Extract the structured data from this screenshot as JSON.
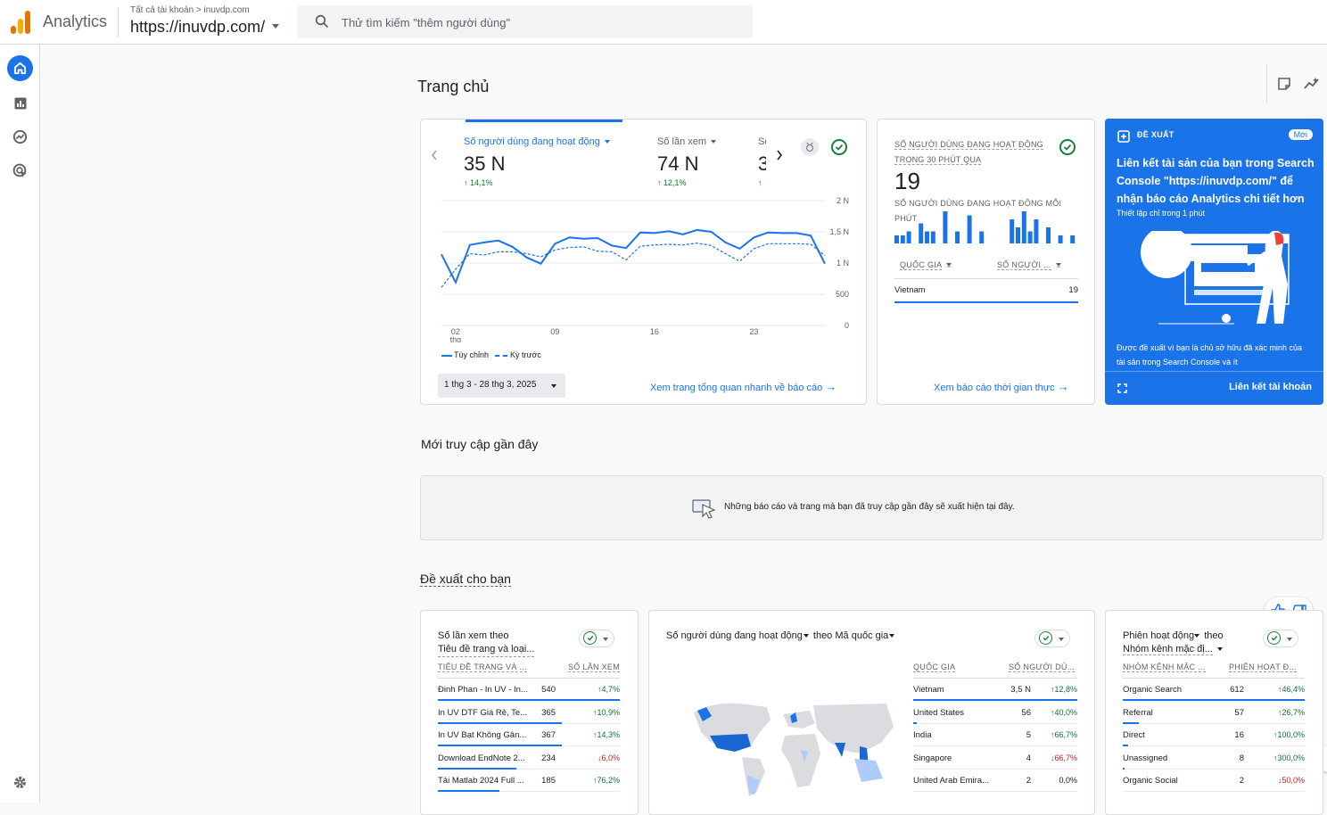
{
  "app": {
    "name": "Analytics",
    "breadcrumb": "Tất cả tài khoản > inuvdp.com",
    "property": "https://inuvdp.com/"
  },
  "search": {
    "placeholder": "Thử tìm kiếm \"thêm người dùng\""
  },
  "page": {
    "title": "Trang chủ"
  },
  "overview": {
    "metrics": [
      {
        "label": "Số người dùng đang hoạt động",
        "value": "35 N",
        "delta": "14,1%"
      },
      {
        "label": "Số lần xem",
        "value": "74 N",
        "delta": "12,1%"
      },
      {
        "label": "Số",
        "value": "3",
        "delta": ""
      }
    ],
    "legend_current": "Tùy chỉnh",
    "legend_previous": "Kỳ trước",
    "date_range": "1 thg 3 - 28 thg 3, 2025",
    "link": "Xem trang tổng quan nhanh về báo cáo"
  },
  "chart_data": {
    "type": "line",
    "x_ticks": [
      "02 thg",
      "09",
      "16",
      "23"
    ],
    "y_ticks": [
      "2 N",
      "1,5 N",
      "1 N",
      "500",
      "0"
    ],
    "ylim": [
      0,
      2000
    ],
    "series": [
      {
        "name": "Tùy chỉnh",
        "values": [
          1140,
          690,
          1290,
          1330,
          1360,
          1260,
          1090,
          990,
          1310,
          1410,
          1390,
          1400,
          1280,
          1240,
          1490,
          1480,
          1510,
          1460,
          1530,
          1500,
          1330,
          1230,
          1410,
          1490,
          1480,
          1480,
          1440,
          990
        ]
      },
      {
        "name": "Kỳ trước",
        "values": [
          610,
          900,
          1150,
          1130,
          1180,
          1180,
          1150,
          1100,
          1210,
          1250,
          1260,
          1190,
          1180,
          1050,
          1270,
          1290,
          1300,
          1290,
          1320,
          1280,
          1150,
          1030,
          1230,
          1310,
          1310,
          1310,
          1300,
          1120
        ]
      }
    ]
  },
  "realtime": {
    "header": "SỐ NGƯỜI DÙNG ĐANG HOẠT ĐỘNG TRONG 30 PHÚT QUA",
    "value": "19",
    "sub_header": "SỐ NGƯỜI DÙNG ĐANG HOẠT ĐỘNG MỖI PHÚT",
    "bars": [
      2,
      2,
      3,
      0,
      5,
      3,
      3,
      0,
      8,
      0,
      3,
      0,
      7,
      0,
      3,
      0,
      0,
      0,
      0,
      6,
      4,
      8,
      3,
      6,
      0,
      4,
      0,
      2,
      0,
      2
    ],
    "col_country": "QUỐC GIA",
    "col_users": "SỐ NGƯỜI ...",
    "rows": [
      {
        "name": "Vietnam",
        "value": "19"
      }
    ],
    "link": "Xem báo cáo thời gian thực"
  },
  "suggestion": {
    "header": "ĐỀ XUẤT",
    "badge": "Mới",
    "title": "Liên kết tài sản của bạn trong Search Console \"https://inuvdp.com/\" để nhận báo cáo Analytics chi tiết hơn",
    "subtitle": "Thiết lập chỉ trong 1 phút",
    "description": "Được đề xuất vì bạn là chủ sở hữu đã xác minh của tài sản trong Search Console và ít",
    "action": "Liên kết tài khoản"
  },
  "recent": {
    "title": "Mới truy cập gần đây",
    "empty_text": "Những báo cáo và trang mà bạn đã truy cập gần đây sẽ xuất hiện tại đây."
  },
  "for_you": {
    "title": "Đề xuất cho bạn",
    "pages_card": {
      "title_line1": "Số lần xem theo",
      "title_line2": "Tiêu đề trang và loại...",
      "col1": "TIÊU ĐỀ TRANG VÀ ...",
      "col2": "SỐ LẦN XEM",
      "rows": [
        {
          "name": "Đinh Phan - In UV - In...",
          "value": "540",
          "delta": "4,7%",
          "dir": "up",
          "share": 1.0
        },
        {
          "name": "In UV DTF Giá Rẻ, Te...",
          "value": "365",
          "delta": "10,9%",
          "dir": "up",
          "share": 0.68
        },
        {
          "name": "In UV Bạt Không Gân...",
          "value": "367",
          "delta": "14,3%",
          "dir": "up",
          "share": 0.68
        },
        {
          "name": "Download EndNote 2...",
          "value": "234",
          "delta": "6,0%",
          "dir": "down",
          "share": 0.43
        },
        {
          "name": "Tải Matlab 2024 Full ...",
          "value": "185",
          "delta": "76,2%",
          "dir": "up",
          "share": 0.34
        }
      ]
    },
    "country_card": {
      "title_metric": "Số người dùng đang hoạt động",
      "title_by": "theo",
      "title_dim": "Mã quốc gia",
      "col1": "QUỐC GIA",
      "col2": "SỐ NGƯỜI DÙ...",
      "rows": [
        {
          "name": "Vietnam",
          "value": "3,5 N",
          "delta": "12,8%",
          "dir": "up",
          "share": 1.0
        },
        {
          "name": "United States",
          "value": "56",
          "delta": "40,0%",
          "dir": "up",
          "share": 0.02
        },
        {
          "name": "India",
          "value": "5",
          "delta": "66,7%",
          "dir": "up",
          "share": 0.0
        },
        {
          "name": "Singapore",
          "value": "4",
          "delta": "66,7%",
          "dir": "down",
          "share": 0.0
        },
        {
          "name": "United Arab Emira...",
          "value": "2",
          "delta": "0,0%",
          "dir": "none",
          "share": 0.0
        }
      ]
    },
    "channel_card": {
      "title_line1": "Phiên hoạt động",
      "title_by": "theo",
      "title_line2": "Nhóm kênh mặc đị...",
      "col1": "NHÓM KÊNH MẶC ...",
      "col2": "PHIÊN HOẠT Đ...",
      "rows": [
        {
          "name": "Organic Search",
          "value": "612",
          "delta": "46,4%",
          "dir": "up",
          "share": 1.0
        },
        {
          "name": "Referral",
          "value": "57",
          "delta": "26,7%",
          "dir": "up",
          "share": 0.09
        },
        {
          "name": "Direct",
          "value": "16",
          "delta": "100,0%",
          "dir": "up",
          "share": 0.03
        },
        {
          "name": "Unassigned",
          "value": "8",
          "delta": "300,0%",
          "dir": "up",
          "share": 0.01
        },
        {
          "name": "Organic Social",
          "value": "2",
          "delta": "50,0%",
          "dir": "down",
          "share": 0.0
        }
      ]
    }
  },
  "colors": {
    "primary": "#1a73e8",
    "positive": "#137333",
    "negative": "#c5221f",
    "map_land": "#dadce0"
  }
}
